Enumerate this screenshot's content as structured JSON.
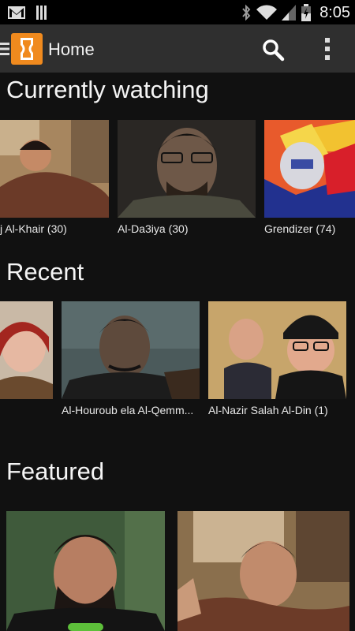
{
  "status_bar": {
    "time": "8:05",
    "icons": [
      "gmail-icon",
      "signal-bars-icon",
      "bluetooth-icon",
      "wifi-icon",
      "cell-signal-icon",
      "battery-icon"
    ]
  },
  "app_bar": {
    "title": "Home",
    "icons": [
      "menu-icon",
      "app-logo-icon",
      "search-icon",
      "more-vert-icon"
    ]
  },
  "colors": {
    "accent": "#f08a1e",
    "background": "#111111",
    "app_bar": "#2f2f2f"
  },
  "sections": {
    "currently_watching": {
      "title": "Currently watching",
      "items": [
        {
          "caption": "j Al-Khair (30)"
        },
        {
          "caption": "Al-Da3iya (30)"
        },
        {
          "caption": "Grendizer (74)"
        }
      ]
    },
    "recent": {
      "title": "Recent",
      "items": [
        {
          "caption": ""
        },
        {
          "caption": "Al-Houroub ela Al-Qemm..."
        },
        {
          "caption": "Al-Nazir Salah Al-Din (1)"
        }
      ]
    },
    "featured": {
      "title": "Featured",
      "items": [
        {
          "caption": ""
        },
        {
          "caption": ""
        }
      ]
    }
  }
}
